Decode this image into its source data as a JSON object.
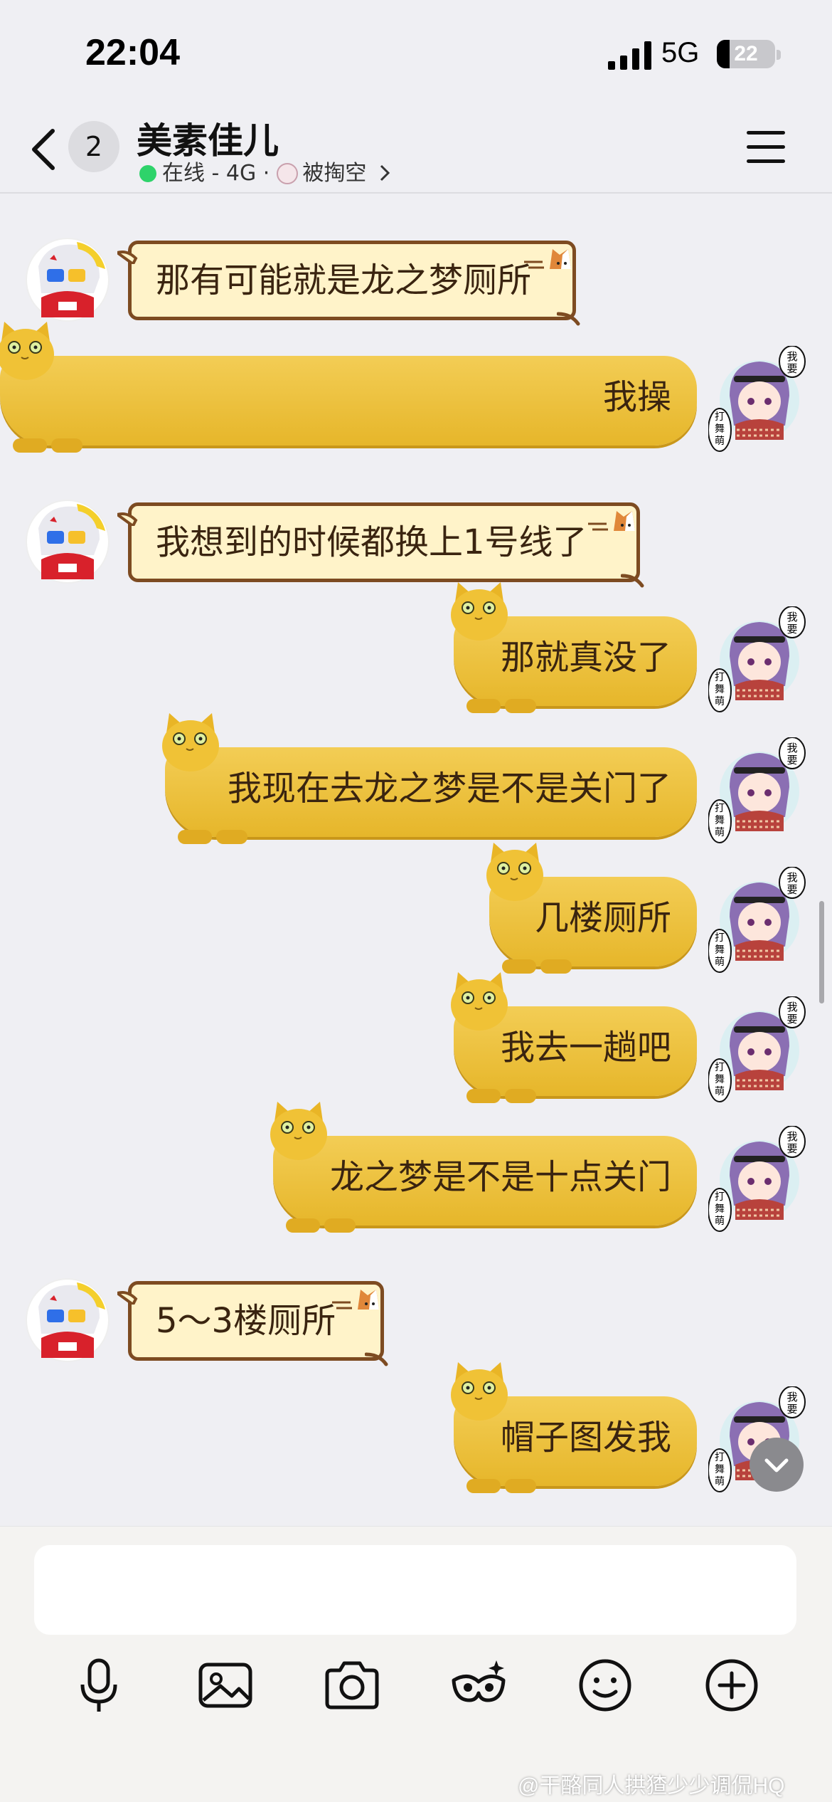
{
  "status_bar": {
    "time": "22:04",
    "network": "5G",
    "battery_level": "22",
    "battery_fraction": 0.22
  },
  "header": {
    "unread_count": "2",
    "contact_name": "美素佳儿",
    "status_online": "在线",
    "status_network": "- 4G ·",
    "status_activity": "被掏空"
  },
  "messages": [
    {
      "side": "left",
      "text": "那有可能就是龙之梦厕所"
    },
    {
      "side": "right",
      "text": "我操"
    },
    {
      "side": "left",
      "text": "我想到的时候都换上1号线了"
    },
    {
      "side": "right",
      "text": "那就真没了"
    },
    {
      "side": "right",
      "text": "我现在去龙之梦是不是关门了"
    },
    {
      "side": "right",
      "text": "几楼厕所"
    },
    {
      "side": "right",
      "text": "我去一趟吧"
    },
    {
      "side": "right",
      "text": "龙之梦是不是十点关门"
    },
    {
      "side": "left",
      "text": "5～3楼厕所"
    },
    {
      "side": "right",
      "text": "帽子图发我"
    }
  ],
  "my_avatar_badges": {
    "top": "我要",
    "bottom": "打舞萌"
  },
  "composer": {
    "placeholder": "",
    "tools": [
      "microphone-icon",
      "image-icon",
      "camera-icon",
      "sticker-mask-icon",
      "emoji-icon",
      "plus-icon"
    ]
  },
  "watermark": "@干酪同人拱猹少少调侃HQ",
  "colors": {
    "background": "#efeff3",
    "left_bubble_fill": "#fff3c9",
    "left_bubble_border": "#7d4b21",
    "right_bubble_fill": "#ecc23f",
    "online_dot": "#2ed36a"
  }
}
